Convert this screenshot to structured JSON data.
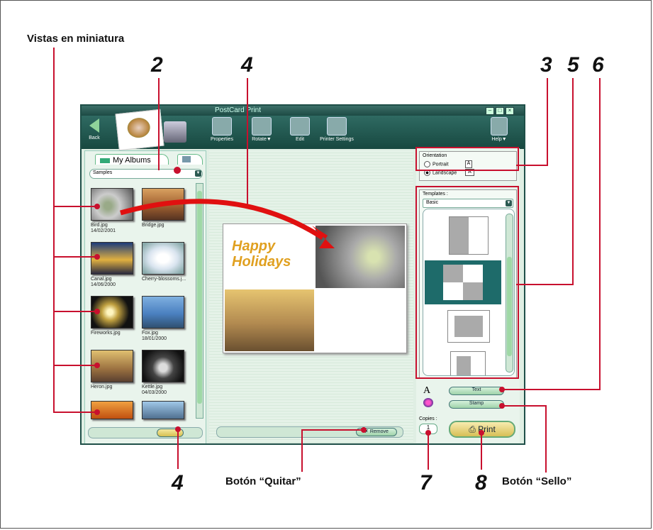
{
  "annotations": {
    "thumbnails_label": "Vistas en miniatura",
    "num_2": "2",
    "num_4_top": "4",
    "num_3": "3",
    "num_5": "5",
    "num_6": "6",
    "num_4_bottom": "4",
    "num_7": "7",
    "num_8": "8",
    "remove_caption": "Botón “Quitar”",
    "stamp_caption": "Botón “Sello”"
  },
  "window": {
    "title": "PostCard Print",
    "toolbar": {
      "back": "Back",
      "properties": "Properties",
      "rotate": "Rotate▼",
      "edit": "Edit",
      "printer_settings": "Printer Settings",
      "help": "Help▼"
    },
    "albums_tab": "My Albums",
    "album_select": "Samples",
    "thumbnails": [
      {
        "name": "Bird.jpg",
        "date": "14/02/2001"
      },
      {
        "name": "Bridge.jpg",
        "date": ""
      },
      {
        "name": "Canal.jpg",
        "date": "14/06/2000"
      },
      {
        "name": "Cherry-blossoms.j...",
        "date": ""
      },
      {
        "name": "Fireworks.jpg",
        "date": ""
      },
      {
        "name": "Fox.jpg",
        "date": "18/01/2000"
      },
      {
        "name": "Heron.jpg",
        "date": ""
      },
      {
        "name": "Kettle.jpg",
        "date": "04/03/2000"
      }
    ],
    "postcard_text": "Happy Holidays",
    "orientation": {
      "label": "Orientation",
      "portrait": "Portrait",
      "landscape": "Landscape",
      "selected": "Landscape"
    },
    "templates": {
      "label": "Templates :",
      "selected": "Basic"
    },
    "text_button": "Text",
    "stamp_button": "Stamp",
    "remove_button": "Remove",
    "copies_label": "Copies :",
    "copies_value": "1",
    "print_button": "Print"
  }
}
